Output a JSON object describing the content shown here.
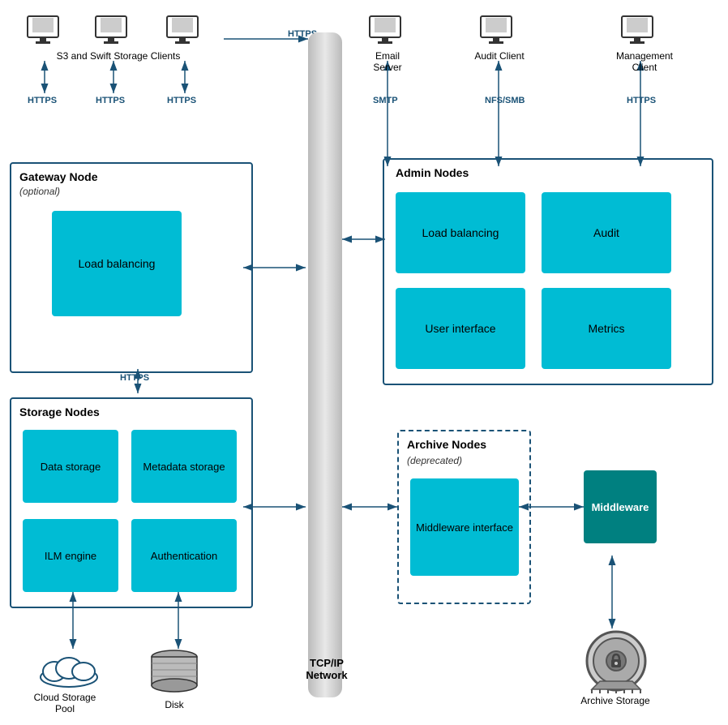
{
  "clients": {
    "s3_swift_label": "S3 and Swift Storage Clients",
    "email_server_label": "Email Server",
    "audit_client_label": "Audit Client",
    "management_client_label": "Management Client"
  },
  "protocols": {
    "https1": "HTTPS",
    "https2": "HTTPS",
    "https3": "HTTPS",
    "https4": "HTTPS",
    "smtp": "SMTP",
    "nfs_smb": "NFS/SMB",
    "https5": "HTTPS",
    "https6": "HTTPS"
  },
  "gateway_node": {
    "title": "Gateway Node",
    "subtitle": "(optional)",
    "load_balancing": "Load\nbalancing"
  },
  "admin_nodes": {
    "title": "Admin Nodes",
    "load_balancing": "Load\nbalancing",
    "audit": "Audit",
    "user_interface": "User interface",
    "metrics": "Metrics"
  },
  "storage_nodes": {
    "title": "Storage Nodes",
    "data_storage": "Data storage",
    "metadata_storage": "Metadata\nstorage",
    "ilm_engine": "ILM engine",
    "authentication": "Authentication"
  },
  "archive_nodes": {
    "title": "Archive Nodes",
    "subtitle": "(deprecated)",
    "middleware_interface": "Middleware\ninterface"
  },
  "middleware": {
    "label": "Middleware"
  },
  "network": {
    "tcp_ip": "TCP/IP\nNetwork"
  },
  "bottom_labels": {
    "cloud_storage": "Cloud Storage Pool",
    "disk": "Disk",
    "archive_storage": "Archive Storage"
  }
}
